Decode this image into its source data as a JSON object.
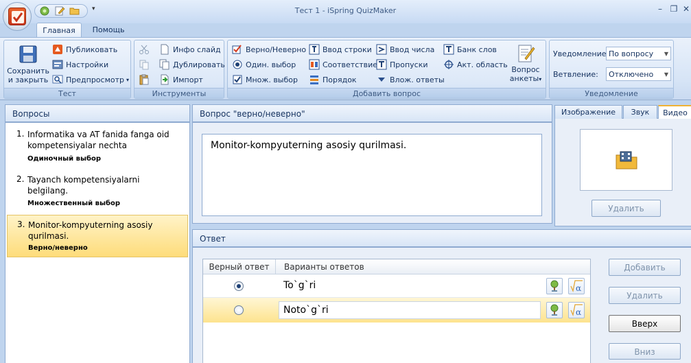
{
  "window": {
    "title": "Тест 1 - iSpring QuizMaker"
  },
  "tabs": [
    {
      "label": "Главная",
      "active": true
    },
    {
      "label": "Помощь",
      "active": false
    }
  ],
  "ribbon": {
    "groups": {
      "test": {
        "label": "Тест",
        "save_close": [
          "Сохранить",
          "и закрыть"
        ],
        "publish": "Публиковать",
        "settings": "Настройки",
        "preview": "Предпросмотр"
      },
      "tools": {
        "label": "Инструменты",
        "slide_info": "Инфо слайд",
        "duplicate": "Дублировать",
        "import": "Импорт"
      },
      "add_question": {
        "label": "Добавить вопрос",
        "true_false": "Верно/Неверно",
        "single_choice": "Один. выбор",
        "multiple_choice": "Множ. выбор",
        "type_in": "Ввод строки",
        "matching": "Соответствие",
        "sequence": "Порядок",
        "numeric": "Ввод числа",
        "fill_blanks": "Пропуски",
        "multiple_response": "Влож. ответы",
        "word_bank": "Банк слов",
        "hotspot": "Акт. область",
        "survey": [
          "Вопрос",
          "анкеты"
        ]
      },
      "notification": {
        "label": "Уведомление",
        "notify_label": "Уведомление:",
        "notify_value": "По вопросу",
        "branch_label": "Ветвление:",
        "branch_value": "Отключено"
      }
    }
  },
  "questions_panel": {
    "title": "Вопросы",
    "items": [
      {
        "num": "1.",
        "text": "Informatika va AT fanida fanga oid kompetensiyalar nechta",
        "type": "Одиночный выбор"
      },
      {
        "num": "2.",
        "text": "Tayanch kompetensiyalarni belgilang.",
        "type": "Множественный выбор"
      },
      {
        "num": "3.",
        "text": "Monitor-kompyuterning asosiy qurilmasi.",
        "type": "Верно/неверно",
        "selected": true
      }
    ]
  },
  "question_panel": {
    "title": "Вопрос \"верно/неверно\"",
    "text": "Monitor-kompyuterning asosiy qurilmasi."
  },
  "media_panel": {
    "tabs": [
      "Изображение",
      "Звук",
      "Видео"
    ],
    "active_tab": "Видео",
    "delete_label": "Удалить"
  },
  "answer_panel": {
    "title": "Ответ",
    "columns": [
      "Верный ответ",
      "Варианты ответов"
    ],
    "rows": [
      {
        "text": "To`g`ri",
        "correct": true
      },
      {
        "text": "Noto`g`ri",
        "correct": false
      }
    ],
    "buttons": {
      "add": "Добавить",
      "delete": "Удалить",
      "up": "Вверх",
      "down": "Вниз"
    }
  }
}
